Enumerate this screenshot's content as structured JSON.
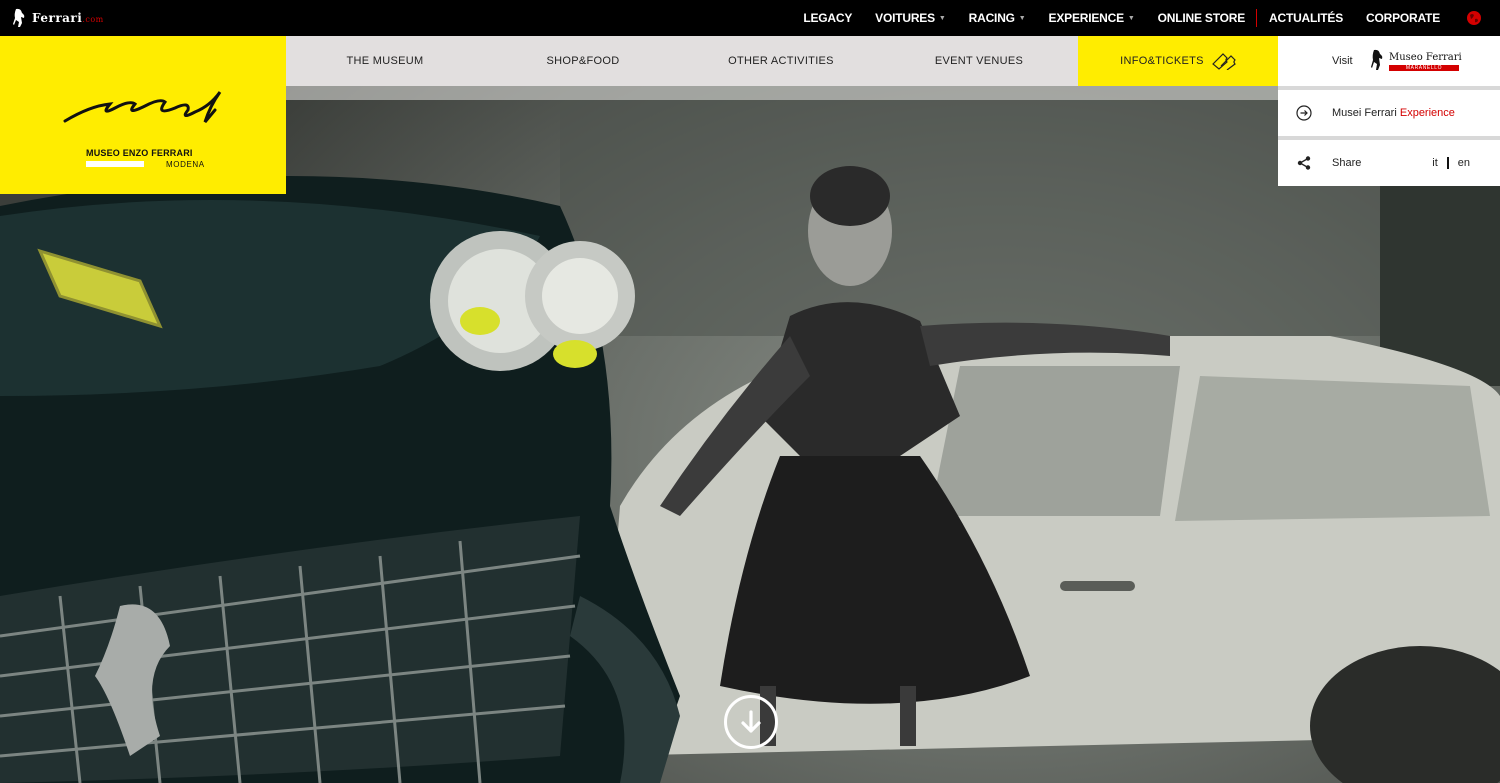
{
  "brand": {
    "name": "Ferrari",
    "suffix": ".com"
  },
  "topnav": {
    "items": [
      {
        "label": "LEGACY",
        "dropdown": false
      },
      {
        "label": "VOITURES",
        "dropdown": true
      },
      {
        "label": "RACING",
        "dropdown": true
      },
      {
        "label": "EXPERIENCE",
        "dropdown": true
      },
      {
        "label": "ONLINE STORE",
        "dropdown": false
      },
      {
        "label": "ACTUALITÉS",
        "dropdown": false
      },
      {
        "label": "CORPORATE",
        "dropdown": false
      }
    ],
    "globe_icon": "globe-icon"
  },
  "museum_logo": {
    "name": "MUSEO ENZO FERRARI",
    "city": "MODENA",
    "color": "#ffed00"
  },
  "subnav": {
    "items": [
      "THE MUSEUM",
      "SHOP&FOOD",
      "OTHER ACTIVITIES",
      "EVENT VENUES"
    ],
    "tickets": {
      "label": "INFO&TICKETS",
      "icon": "tickets-icon"
    }
  },
  "right_panel": {
    "visit": {
      "label": "Visit",
      "logo_name": "Museo Ferrari",
      "logo_sub": "MARANELLO"
    },
    "experience": {
      "prefix": "Musei Ferrari",
      "highlight": "Experience",
      "icon": "arrow-circle-icon"
    },
    "share": {
      "label": "Share",
      "icon": "share-icon"
    },
    "languages": [
      "it",
      "en"
    ]
  },
  "scroll_button": {
    "icon": "arrow-down-circle-icon"
  },
  "colors": {
    "accent_yellow": "#ffed00",
    "ferrari_red": "#d40000",
    "subnav_bg": "#e2dfdf"
  }
}
